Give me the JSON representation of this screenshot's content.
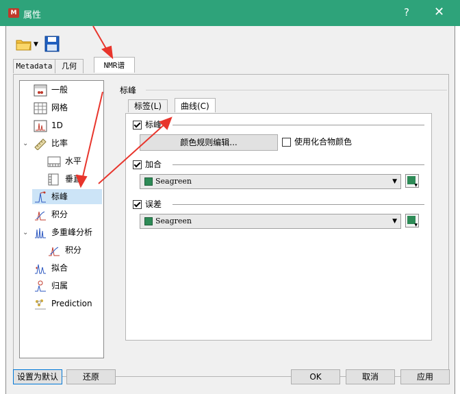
{
  "window": {
    "title": "属性",
    "help_label": "?",
    "close_label": "✕",
    "app_icon_label": "M"
  },
  "top_tabs": [
    {
      "label": "Metadata"
    },
    {
      "label": "几何"
    },
    {
      "label": "NMR谱"
    }
  ],
  "tree": {
    "items": [
      {
        "label": "一般",
        "icon": "title-icon"
      },
      {
        "label": "网格",
        "icon": "grid-icon"
      },
      {
        "label": "1D",
        "icon": "spectrum-1d-icon"
      },
      {
        "label": "比率",
        "icon": "ruler-icon"
      },
      {
        "label": "水平",
        "icon": "horizontal-ruler-icon"
      },
      {
        "label": "垂直",
        "icon": "vertical-ruler-icon"
      },
      {
        "label": "标峰",
        "icon": "peak-label-icon"
      },
      {
        "label": "积分",
        "icon": "integral-icon"
      },
      {
        "label": "多重峰分析",
        "icon": "multiplet-icon"
      },
      {
        "label": "积分",
        "icon": "integral-icon"
      },
      {
        "label": "拟合",
        "icon": "fit-icon"
      },
      {
        "label": "归属",
        "icon": "assignment-icon"
      },
      {
        "label": "Prediction",
        "icon": "prediction-icon"
      }
    ]
  },
  "group": {
    "title": "标峰",
    "subtabs": [
      {
        "label": "标签(L)"
      },
      {
        "label": "曲线(C)"
      }
    ],
    "peaks_check_label": "标峰",
    "color_rules_button": "颜色规则编辑...",
    "use_compound_color_label": "使用化合物颜色",
    "sum_check_label": "加合",
    "sum_color_value": "Seagreen",
    "residual_check_label": "误差",
    "residual_color_value": "Seagreen",
    "accent_color": "#2e8b57"
  },
  "footer": {
    "set_default": "设置为默认",
    "restore": "还原",
    "ok": "OK",
    "cancel": "取消",
    "apply": "应用"
  }
}
